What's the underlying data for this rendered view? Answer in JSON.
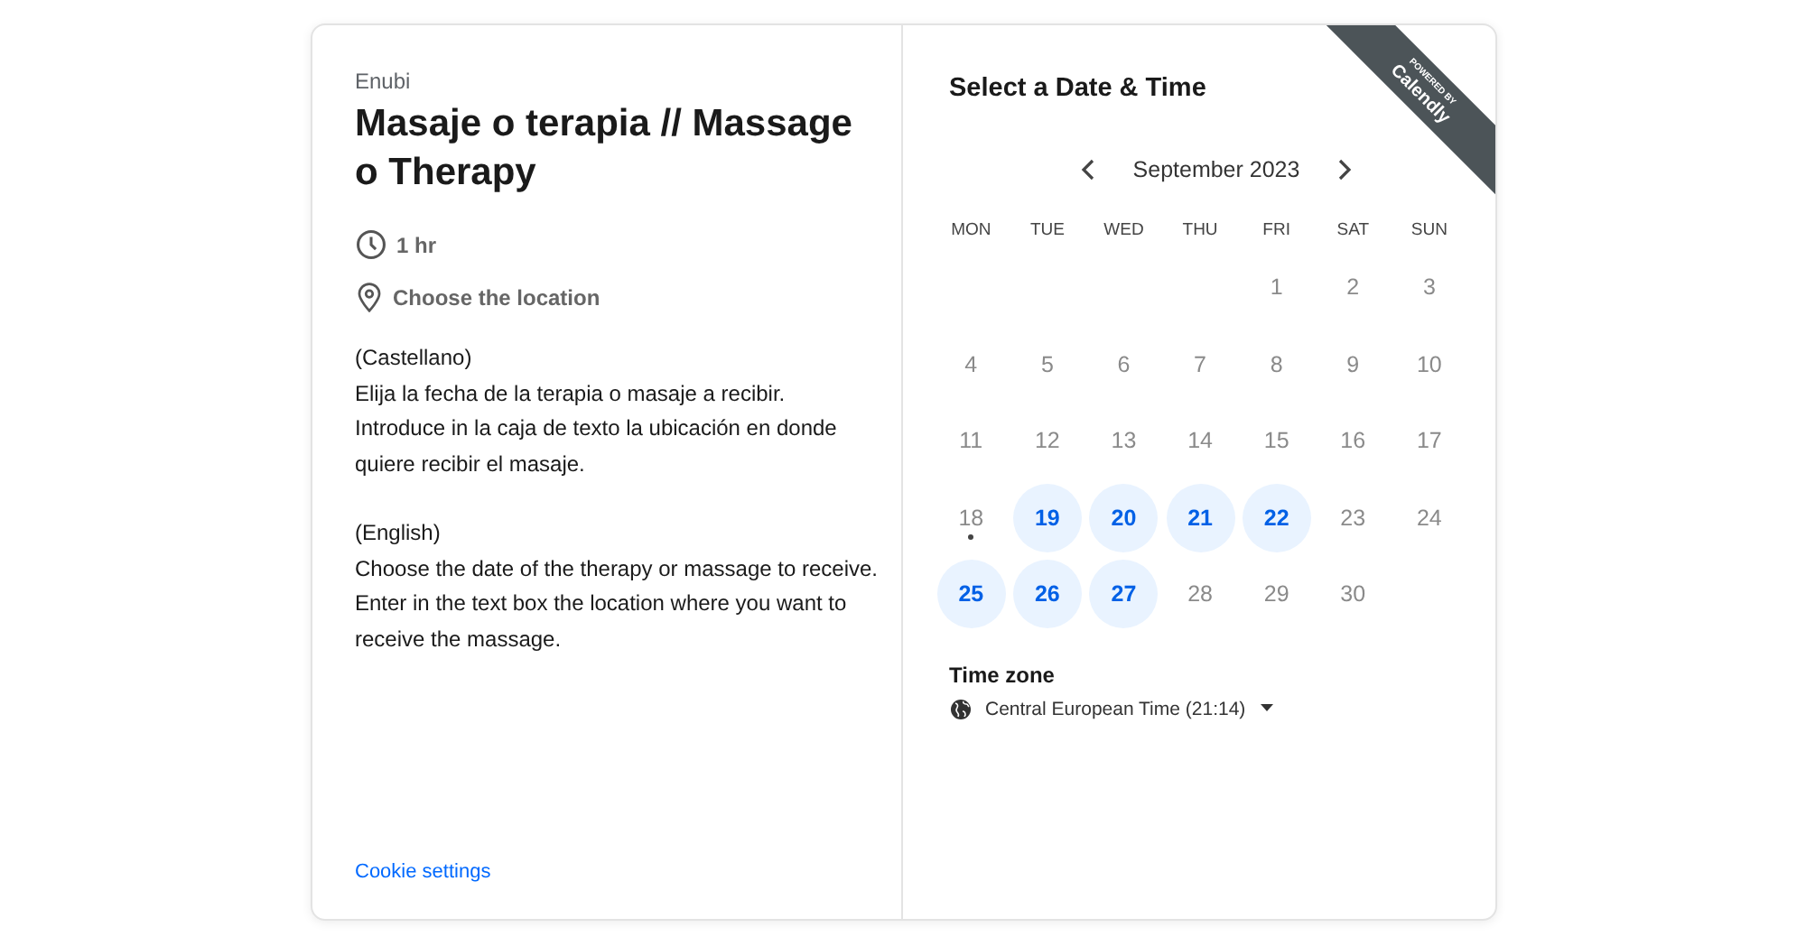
{
  "event": {
    "organizer": "Enubi",
    "title": "Masaje o terapia // Massage o Therapy",
    "duration": "1 hr",
    "location": "Choose the location",
    "description": [
      [
        "(Castellano)",
        "Elija la fecha de la terapia o masaje a recibir. Introduce in la caja de texto la ubicación en donde quiere recibir el masaje."
      ],
      [
        "(English)",
        "Choose the date of the therapy or massage to receive. Enter in the text box the location where you want to receive the massage."
      ]
    ],
    "cookie_link": "Cookie settings"
  },
  "badge": {
    "line_1": "POWERED BY",
    "line_2": "Calendly"
  },
  "scheduler": {
    "heading": "Select a Date & Time",
    "month": "September 2023",
    "prev": {
      "disabled": false
    },
    "next": {
      "disabled": false
    },
    "weekdays": [
      "MON",
      "TUE",
      "WED",
      "THU",
      "FRI",
      "SAT",
      "SUN"
    ],
    "weeks": [
      [
        {
          "kind": "blank"
        },
        {
          "kind": "blank"
        },
        {
          "kind": "blank"
        },
        {
          "kind": "blank"
        },
        {
          "kind": "day",
          "day": "1",
          "available": false,
          "today": false
        },
        {
          "kind": "day",
          "day": "2",
          "available": false,
          "today": false
        },
        {
          "kind": "day",
          "day": "3",
          "available": false,
          "today": false
        }
      ],
      [
        {
          "kind": "day",
          "day": "4",
          "available": false,
          "today": false
        },
        {
          "kind": "day",
          "day": "5",
          "available": false,
          "today": false
        },
        {
          "kind": "day",
          "day": "6",
          "available": false,
          "today": false
        },
        {
          "kind": "day",
          "day": "7",
          "available": false,
          "today": false
        },
        {
          "kind": "day",
          "day": "8",
          "available": false,
          "today": false
        },
        {
          "kind": "day",
          "day": "9",
          "available": false,
          "today": false
        },
        {
          "kind": "day",
          "day": "10",
          "available": false,
          "today": false
        }
      ],
      [
        {
          "kind": "day",
          "day": "11",
          "available": false,
          "today": false
        },
        {
          "kind": "day",
          "day": "12",
          "available": false,
          "today": false
        },
        {
          "kind": "day",
          "day": "13",
          "available": false,
          "today": false
        },
        {
          "kind": "day",
          "day": "14",
          "available": false,
          "today": false
        },
        {
          "kind": "day",
          "day": "15",
          "available": false,
          "today": false
        },
        {
          "kind": "day",
          "day": "16",
          "available": false,
          "today": false
        },
        {
          "kind": "day",
          "day": "17",
          "available": false,
          "today": false
        }
      ],
      [
        {
          "kind": "day",
          "day": "18",
          "available": false,
          "today": true
        },
        {
          "kind": "day",
          "day": "19",
          "available": true,
          "today": false
        },
        {
          "kind": "day",
          "day": "20",
          "available": true,
          "today": false
        },
        {
          "kind": "day",
          "day": "21",
          "available": true,
          "today": false
        },
        {
          "kind": "day",
          "day": "22",
          "available": true,
          "today": false
        },
        {
          "kind": "day",
          "day": "23",
          "available": false,
          "today": false
        },
        {
          "kind": "day",
          "day": "24",
          "available": false,
          "today": false
        }
      ],
      [
        {
          "kind": "day",
          "day": "25",
          "available": true,
          "today": false
        },
        {
          "kind": "day",
          "day": "26",
          "available": true,
          "today": false
        },
        {
          "kind": "day",
          "day": "27",
          "available": true,
          "today": false
        },
        {
          "kind": "day",
          "day": "28",
          "available": false,
          "today": false
        },
        {
          "kind": "day",
          "day": "29",
          "available": false,
          "today": false
        },
        {
          "kind": "day",
          "day": "30",
          "available": false,
          "today": false
        }
      ]
    ],
    "timezone_label": "Time zone",
    "timezone": "Central European Time (21:14)"
  }
}
